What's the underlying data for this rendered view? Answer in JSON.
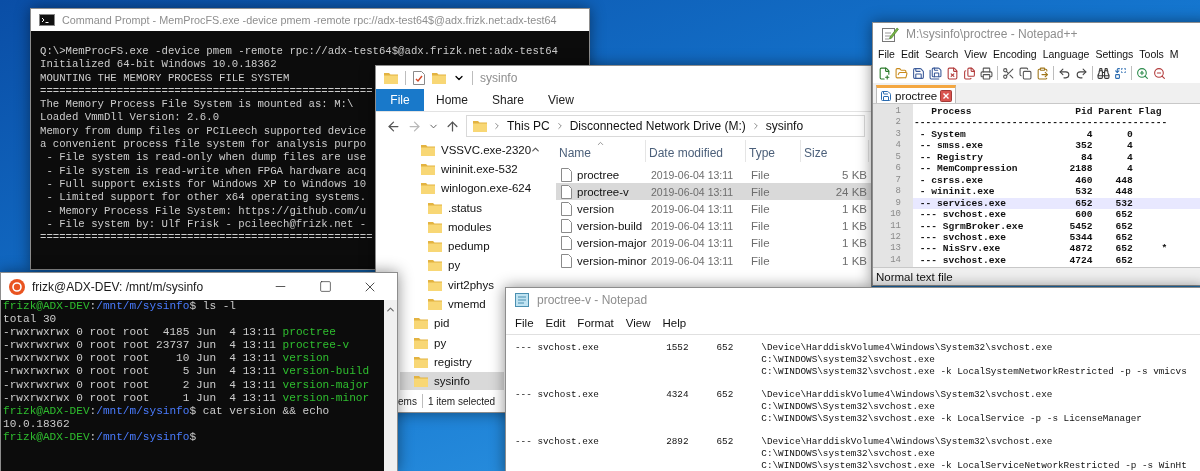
{
  "command_prompt": {
    "title": "Command Prompt - MemProcFS.exe -device pmem -remote rpc://adx-test64$@adx.frizk.net:adx-test64",
    "lines": [
      "Q:\\>MemProcFS.exe -device pmem -remote rpc://adx-test64$@adx.frizk.net:adx-test64",
      "Initialized 64-bit Windows 10.0.18362",
      "MOUNTING THE MEMORY PROCESS FILE SYSTEM",
      "====================================================",
      "The Memory Process File System is mounted as: M:\\",
      "Loaded VmmDll Version: 2.6.0",
      "Memory from dump files or PCILeech supported device",
      "a convenient process file system for analysis purpo",
      " - File system is read-only when dump files are use",
      " - File system is read-write when FPGA hardware acq",
      " - Full support exists for Windows XP to Windows 10",
      " - Limited support for other x64 operating systems.",
      " - Memory Process File System: https://github.com/u",
      " - File system by: Ulf Frisk - pcileech@frizk.net -",
      "===================================================="
    ]
  },
  "explorer": {
    "title": "sysinfo",
    "file_button": "File",
    "ribbon_tabs": [
      "Home",
      "Share",
      "View"
    ],
    "breadcrumbs": [
      "This PC",
      "Disconnected Network Drive (M:)",
      "sysinfo"
    ],
    "tree": [
      {
        "children": [
          {
            "label": "VSSVC.exe-2320",
            "selected": false
          },
          {
            "label": "wininit.exe-532",
            "selected": false
          },
          {
            "label": "winlogon.exe-624",
            "selected": false,
            "children": [
              {
                "label": ".status",
                "selected": false
              },
              {
                "label": "modules",
                "selected": false
              },
              {
                "label": "pedump",
                "selected": false
              },
              {
                "label": "py",
                "selected": false
              },
              {
                "label": "virt2phys",
                "selected": false
              },
              {
                "label": "vmemd",
                "selected": false
              }
            ]
          }
        ]
      },
      {
        "label": "pid",
        "selected": false
      },
      {
        "label": "py",
        "selected": false
      },
      {
        "label": "registry",
        "selected": false
      },
      {
        "label": "sysinfo",
        "selected": true
      }
    ],
    "columns": [
      "Name",
      "Date modified",
      "Type",
      "Size"
    ],
    "files": [
      {
        "name": "proctree",
        "date": "2019-06-04 13:11",
        "type": "File",
        "size": "5 KB",
        "selected": false
      },
      {
        "name": "proctree-v",
        "date": "2019-06-04 13:11",
        "type": "File",
        "size": "24 KB",
        "selected": true
      },
      {
        "name": "version",
        "date": "2019-06-04 13:11",
        "type": "File",
        "size": "1 KB",
        "selected": false
      },
      {
        "name": "version-build",
        "date": "2019-06-04 13:11",
        "type": "File",
        "size": "1 KB",
        "selected": false
      },
      {
        "name": "version-major",
        "date": "2019-06-04 13:11",
        "type": "File",
        "size": "1 KB",
        "selected": false
      },
      {
        "name": "version-minor",
        "date": "2019-06-04 13:11",
        "type": "File",
        "size": "1 KB",
        "selected": false
      }
    ],
    "status": [
      "ems",
      "1 item selected"
    ]
  },
  "notepad_plus_plus": {
    "title": "M:\\sysinfo\\proctree - Notepad++",
    "menu": [
      "File",
      "Edit",
      "Search",
      "View",
      "Encoding",
      "Language",
      "Settings",
      "Tools",
      "M"
    ],
    "tab": "proctree",
    "lines": [
      {
        "number": "1",
        "text": "   Process                  Pid Parent Flag",
        "current": false
      },
      {
        "number": "2",
        "text": "--------------------------------------------",
        "current": false
      },
      {
        "number": "3",
        "text": " - System                     4      0",
        "current": false
      },
      {
        "number": "4",
        "text": " -- smss.exe                352      4",
        "current": false
      },
      {
        "number": "5",
        "text": " -- Registry                 84      4",
        "current": false
      },
      {
        "number": "6",
        "text": " -- MemCompression         2188      4",
        "current": false
      },
      {
        "number": "7",
        "text": " - csrss.exe                460    448",
        "current": false
      },
      {
        "number": "8",
        "text": " - wininit.exe              532    448",
        "current": false
      },
      {
        "number": "9",
        "text": " -- services.exe            652    532",
        "current": true
      },
      {
        "number": "10",
        "text": " --- svchost.exe            600    652",
        "current": false
      },
      {
        "number": "11",
        "text": " --- SgrmBroker.exe        5452    652",
        "current": false
      },
      {
        "number": "12",
        "text": " --- svchost.exe           5344    652",
        "current": false
      },
      {
        "number": "13",
        "text": " --- NisSrv.exe            4872    652     *",
        "current": false
      },
      {
        "number": "14",
        "text": " --- svchost.exe           4724    652",
        "current": false
      }
    ],
    "status": "Normal text file"
  },
  "terminal": {
    "title": "frizk@ADX-DEV: /mnt/m/sysinfo",
    "lines": [
      {
        "segments": [
          {
            "kind": "user",
            "text": "frizk@ADX-DEV"
          },
          {
            "kind": "plain",
            "text": ":"
          },
          {
            "kind": "path",
            "text": "/mnt/m/sysinfo"
          },
          {
            "kind": "plain",
            "text": "$ ls -l"
          }
        ]
      },
      {
        "segments": [
          {
            "kind": "plain",
            "text": "total 30"
          }
        ]
      },
      {
        "segments": [
          {
            "kind": "plain",
            "text": "-rwxrwxrwx 0 root root  4185 Jun  4 13:11 "
          },
          {
            "kind": "file",
            "text": "proctree"
          }
        ]
      },
      {
        "segments": [
          {
            "kind": "plain",
            "text": "-rwxrwxrwx 0 root root 23737 Jun  4 13:11 "
          },
          {
            "kind": "file",
            "text": "proctree-v"
          }
        ]
      },
      {
        "segments": [
          {
            "kind": "plain",
            "text": "-rwxrwxrwx 0 root root    10 Jun  4 13:11 "
          },
          {
            "kind": "file",
            "text": "version"
          }
        ]
      },
      {
        "segments": [
          {
            "kind": "plain",
            "text": "-rwxrwxrwx 0 root root     5 Jun  4 13:11 "
          },
          {
            "kind": "file",
            "text": "version-build"
          }
        ]
      },
      {
        "segments": [
          {
            "kind": "plain",
            "text": "-rwxrwxrwx 0 root root     2 Jun  4 13:11 "
          },
          {
            "kind": "file",
            "text": "version-major"
          }
        ]
      },
      {
        "segments": [
          {
            "kind": "plain",
            "text": "-rwxrwxrwx 0 root root     1 Jun  4 13:11 "
          },
          {
            "kind": "file",
            "text": "version-minor"
          }
        ]
      },
      {
        "segments": [
          {
            "kind": "user",
            "text": "frizk@ADX-DEV"
          },
          {
            "kind": "plain",
            "text": ":"
          },
          {
            "kind": "path",
            "text": "/mnt/m/sysinfo"
          },
          {
            "kind": "plain",
            "text": "$ cat version && echo"
          }
        ]
      },
      {
        "segments": [
          {
            "kind": "plain",
            "text": "10.0.18362"
          }
        ]
      },
      {
        "segments": [
          {
            "kind": "user",
            "text": "frizk@ADX-DEV"
          },
          {
            "kind": "plain",
            "text": ":"
          },
          {
            "kind": "path",
            "text": "/mnt/m/sysinfo"
          },
          {
            "kind": "plain",
            "text": "$"
          }
        ]
      }
    ]
  },
  "notepad": {
    "title": "proctree-v - Notepad",
    "menu": [
      "File",
      "Edit",
      "Format",
      "View",
      "Help"
    ],
    "entries": [
      {
        "lines": [
          "--- svchost.exe            1552     652     \\Device\\HarddiskVolume4\\Windows\\System32\\svchost.exe",
          "C:\\WINDOWS\\system32\\svchost.exe",
          "C:\\WINDOWS\\system32\\svchost.exe -k LocalSystemNetworkRestricted -p -s vmicvs"
        ]
      },
      {
        "lines": [
          "--- svchost.exe            4324     652     \\Device\\HarddiskVolume4\\Windows\\System32\\svchost.exe",
          "C:\\WINDOWS\\System32\\svchost.exe",
          "C:\\WINDOWS\\System32\\svchost.exe -k LocalService -p -s LicenseManager"
        ]
      },
      {
        "lines": [
          "--- svchost.exe            2892     652     \\Device\\HarddiskVolume4\\Windows\\System32\\svchost.exe",
          "C:\\WINDOWS\\system32\\svchost.exe",
          "C:\\WINDOWS\\system32\\svchost.exe -k LocalServiceNetworkRestricted -p -s WinHt"
        ]
      }
    ]
  }
}
